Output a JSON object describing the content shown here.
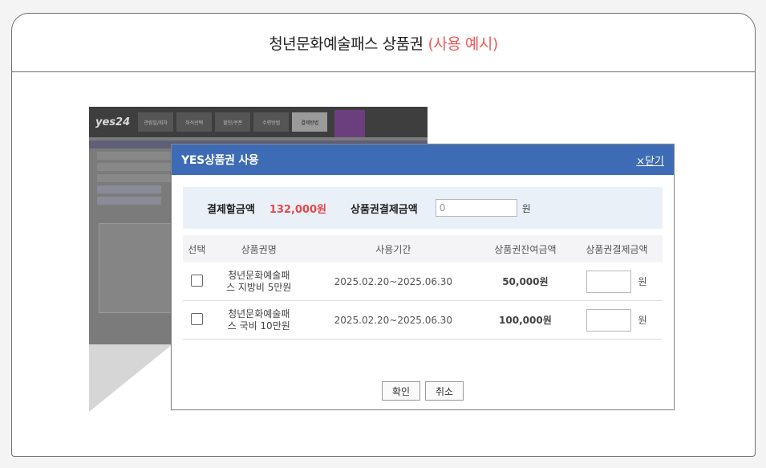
{
  "header": {
    "title": "청년문화예술패스 상품권",
    "highlight": "(사용 예시)"
  },
  "background": {
    "logo": "yes24",
    "tabs": [
      "관람일/회차",
      "좌석선택",
      "할인/쿠폰",
      "수령방법",
      "결제방법"
    ]
  },
  "dialog": {
    "title": "YES상품권 사용",
    "close_label": "×닫기",
    "summary": {
      "amount_label": "결제할금액",
      "amount_value": "132,000원",
      "voucher_label": "상품권결제금액",
      "voucher_input": "0",
      "unit": "원"
    },
    "columns": [
      "선택",
      "상품권명",
      "사용기간",
      "상품권잔여금액",
      "상품권결제금액"
    ],
    "rows": [
      {
        "name_line1": "청년문화예술패",
        "name_line2": "스 지방비 5만원",
        "period": "2025.02.20~2025.06.30",
        "balance": "50,000원",
        "unit": "원"
      },
      {
        "name_line1": "청년문화예술패",
        "name_line2": "스 국비 10만원",
        "period": "2025.02.20~2025.06.30",
        "balance": "100,000원",
        "unit": "원"
      }
    ],
    "confirm_label": "확인",
    "cancel_label": "취소"
  }
}
